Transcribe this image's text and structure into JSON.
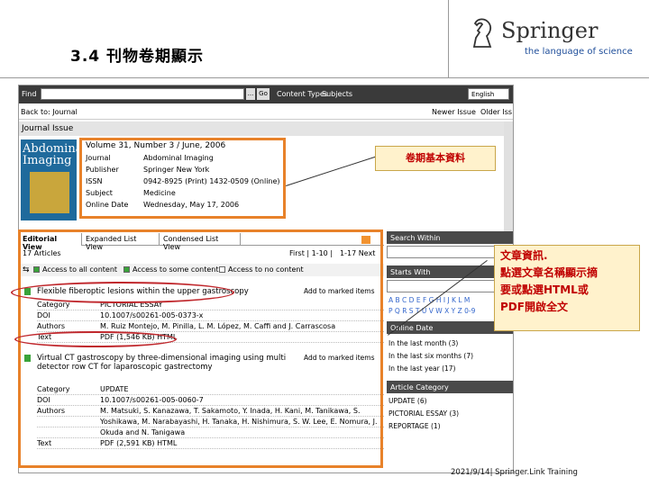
{
  "slide": {
    "title": "3.4 刊物卷期顯示",
    "logo_name": "Springer",
    "logo_tagline": "the language of science",
    "footer": "2021/9/14| Springer.Link Training"
  },
  "toolbar": {
    "find_label": "Find",
    "dots_label": "...",
    "go_label": "Go",
    "content_types": "Content Types",
    "subjects": "Subjects",
    "language": "English"
  },
  "nav": {
    "back": "Back to: Journal",
    "newer": "Newer Issue",
    "older": "Older Iss"
  },
  "issue": {
    "header": "Journal Issue",
    "cover_title": "Abdominal Imaging",
    "volume_line": "Volume 31, Number 3 / June, 2006",
    "meta": [
      {
        "k": "Journal",
        "v": "Abdominal Imaging"
      },
      {
        "k": "Publisher",
        "v": "Springer New York"
      },
      {
        "k": "ISSN",
        "v": "0942-8925 (Print) 1432-0509 (Online)"
      },
      {
        "k": "Subject",
        "v": "Medicine"
      },
      {
        "k": "Online Date",
        "v": "Wednesday, May 17, 2006"
      }
    ]
  },
  "tabs": [
    "Editorial View",
    "Expanded List View",
    "Condensed List View"
  ],
  "articles_bar": {
    "count": "17 Articles",
    "pager": "First | 1-10 |",
    "pager2": "1-17   Next"
  },
  "access": {
    "full": "Access to all content",
    "some": "Access to some content",
    "none": "Access to no content"
  },
  "articles": [
    {
      "title": "Flexible fiberoptic lesions within the upper gastroscopy",
      "mark": "Add to marked items",
      "rows": [
        {
          "k": "Category",
          "v": "PICTORIAL ESSAY"
        },
        {
          "k": "DOI",
          "v": "10.1007/s00261-005-0373-x"
        },
        {
          "k": "Authors",
          "v": "M. Ruiz Montejo, M. Pinilla, L. M. López, M. Caffi and J. Carrascosa"
        },
        {
          "k": "Text",
          "v": "PDF (1,546 KB)  HTML"
        }
      ]
    },
    {
      "title": "Virtual CT gastroscopy by three-dimensional imaging using multi detector row CT for laparoscopic gastrectomy",
      "mark": "Add to marked items",
      "rows": [
        {
          "k": "Category",
          "v": "UPDATE"
        },
        {
          "k": "DOI",
          "v": "10.1007/s00261-005-0060-7"
        },
        {
          "k": "Authors",
          "v": "M. Matsuki, S. Kanazawa, T. Sakamoto, Y. Inada, H. Kani, M. Tanikawa, S."
        },
        {
          "k": "",
          "v": "Yoshikawa, M. Narabayashi, H. Tanaka, H. Nishimura, S. W. Lee, E. Nomura, J."
        },
        {
          "k": "",
          "v": "Okuda and N. Tanigawa"
        },
        {
          "k": "Text",
          "v": "PDF (2,591 KB)  HTML"
        }
      ]
    }
  ],
  "sidebar": {
    "search_within": "Search Within",
    "starts_with": "Starts With",
    "alpha1": "A B C D E F G H I J K L M",
    "alpha2": "P Q R S T U V W X Y Z  0-9",
    "online_date": "Online Date",
    "dates": [
      "In the last month (3)",
      "In the last six months (7)",
      "In the last year (17)"
    ],
    "article_category": "Article Category",
    "categories": [
      "UPDATE (6)",
      "PICTORIAL ESSAY (3)",
      "REPORTAGE (1)"
    ]
  },
  "callouts": {
    "issue_info": "卷期基本資料",
    "article_info_1": "文章資訊.",
    "article_info_2": "點選文章名稱顯示摘",
    "article_info_3": "要或點選HTML或",
    "article_info_4": "PDF開啟全文"
  },
  "colors": {
    "highlight": "#e8822a",
    "ellipse": "#c0282d",
    "callout_text": "#c00000",
    "callout_bg": "#fff2cc",
    "brand_blue": "#1f4e9a"
  }
}
